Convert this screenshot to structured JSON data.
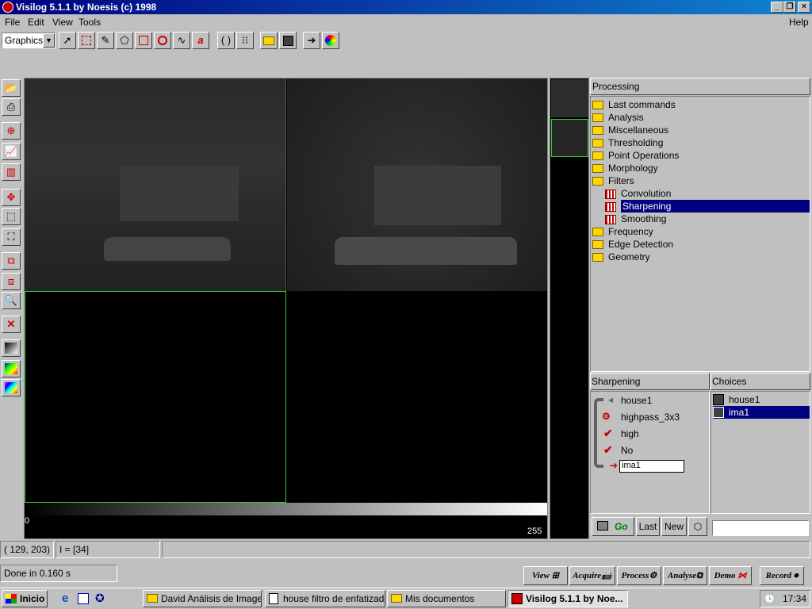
{
  "window": {
    "title": "Visilog 5.1.1 by Noesis (c) 1998"
  },
  "menu": {
    "file": "File",
    "edit": "Edit",
    "view": "View",
    "tools": "Tools",
    "help": "Help"
  },
  "toolbar": {
    "mode_select": "Graphics"
  },
  "gradient": {
    "min": "0",
    "max": "255"
  },
  "processing": {
    "header": "Processing",
    "items": [
      {
        "label": "Last commands"
      },
      {
        "label": "Analysis"
      },
      {
        "label": "Miscellaneous"
      },
      {
        "label": "Thresholding"
      },
      {
        "label": "Point Operations"
      },
      {
        "label": "Morphology"
      },
      {
        "label": "Filters"
      },
      {
        "label": "Convolution"
      },
      {
        "label": "Sharpening"
      },
      {
        "label": "Smoothing"
      },
      {
        "label": "Frequency"
      },
      {
        "label": "Edge Detection"
      },
      {
        "label": "Geometry"
      }
    ]
  },
  "sharpening": {
    "header": "Sharpening",
    "input": "house1",
    "kernel": "highpass_3x3",
    "level": "high",
    "option": "No",
    "output": "ima1"
  },
  "choices": {
    "header": "Choices",
    "items": [
      "house1",
      "ima1"
    ]
  },
  "commands": {
    "go": "Go",
    "last": "Last",
    "new": "New"
  },
  "status": {
    "coords": "( 129, 203)",
    "intensity": "I = [34]",
    "message": "Done in 0.160 s"
  },
  "actions": {
    "view": "View",
    "acquire": "Acquire",
    "process": "Process",
    "analyse": "Analyse",
    "demo": "Demo",
    "record": "Record"
  },
  "taskbar": {
    "start": "Inicio",
    "tasks": [
      "David Análisis de Imagen",
      "house filtro de enfatizado...",
      "Mis documentos",
      "Visilog 5.1.1 by Noe..."
    ],
    "clock": "17:34"
  }
}
